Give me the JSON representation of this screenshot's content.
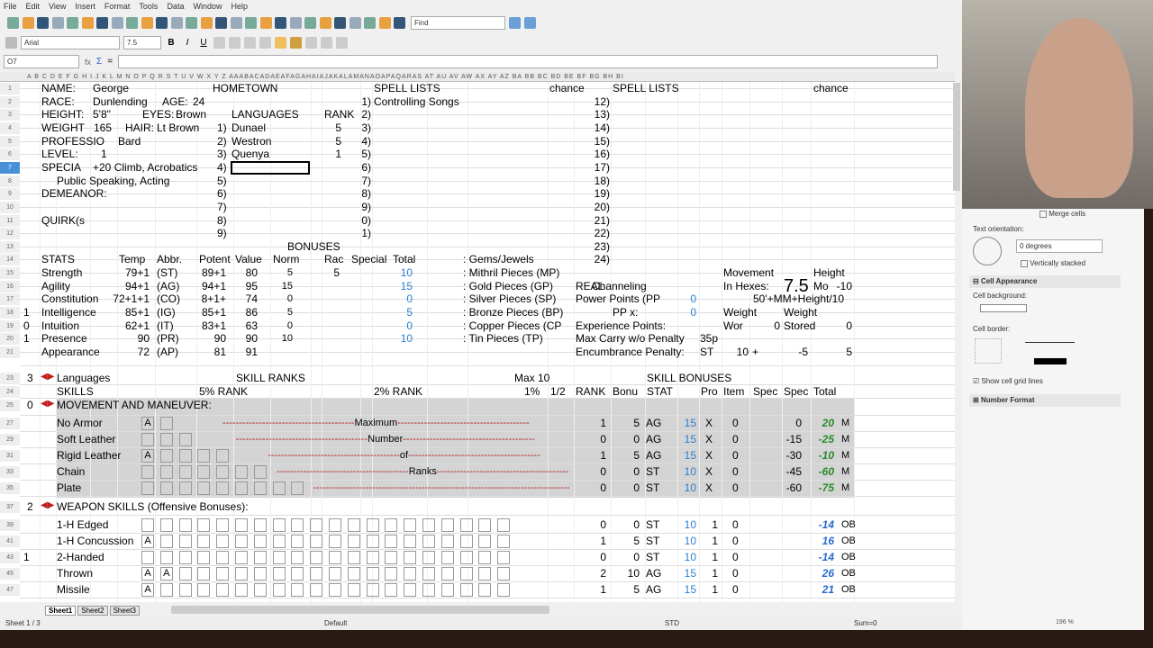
{
  "menu": [
    "File",
    "Edit",
    "View",
    "Insert",
    "Format",
    "Tools",
    "Data",
    "Window",
    "Help"
  ],
  "toolbar": {
    "find_placeholder": "Find",
    "font_name": "Arial",
    "font_size": "7.5",
    "bold": "B",
    "italic": "I",
    "underline": "U"
  },
  "formula_bar": {
    "cell_ref": "O7",
    "fx": "fx",
    "sum": "Σ",
    "eq": "=",
    "content": ""
  },
  "columns": "A  B  C  D  E  F G H I J K L M N O P Q R S T U V W X Y Z AAABACADAEAFAGAHAIAJAKALAMANAOAPAQARAS AT AU AV   AW AX AY AZ  BA  BB  BC  BD  BE BF BG  BH   BI",
  "row_numbers": [
    "1",
    "2",
    "3",
    "4",
    "5",
    "6",
    "7",
    "8",
    "9",
    "10",
    "11",
    "12",
    "13",
    "14",
    "15",
    "16",
    "17",
    "18",
    "19",
    "20",
    "21",
    "23",
    "24",
    "25",
    "27",
    "29",
    "31",
    "33",
    "35",
    "37",
    "39",
    "41",
    "43",
    "45",
    "47"
  ],
  "char": {
    "name_label": "NAME:",
    "name": "George",
    "hometown_label": "HOMETOWN",
    "race_label": "RACE:",
    "race": "Dunlending",
    "age_label": "AGE:",
    "age": "24",
    "height_label": "HEIGHT:",
    "height": "5'8\"",
    "eyes_label": "EYES:",
    "eyes": "Brown",
    "weight_label": "WEIGHT",
    "weight": "165",
    "hair_label": "HAIR:",
    "hair": "Lt Brown",
    "profession_label": "PROFESSIO",
    "profession": "Bard",
    "level_label": "LEVEL:",
    "level": "1",
    "special_label": "SPECIA",
    "special1": "+20 Climb, Acrobatics",
    "special2": "Public Speaking, Acting",
    "demeanor_label": "DEMEANOR:",
    "quirks_label": "QUIRK(s"
  },
  "languages": {
    "header": "LANGUAGES",
    "rank_header": "RANK",
    "items": [
      {
        "num": "1)",
        "name": "Dunael",
        "rank": "5"
      },
      {
        "num": "2)",
        "name": "Westron",
        "rank": "5"
      },
      {
        "num": "3)",
        "name": "Quenya",
        "rank": "1"
      },
      {
        "num": "4)"
      },
      {
        "num": "5)"
      },
      {
        "num": "6)"
      },
      {
        "num": "7)"
      },
      {
        "num": "8)"
      },
      {
        "num": "9)"
      }
    ]
  },
  "spells": {
    "header1": "SPELL LISTS",
    "chance1": "chance",
    "header2": "SPELL LISTS",
    "chance2": "chance",
    "first": "Controlling Songs",
    "nums1": [
      "1)",
      "2)",
      "3)",
      "4)",
      "5)",
      "6)",
      "7)",
      "8)",
      "9)",
      "0)",
      "1)"
    ],
    "nums2": [
      "12)",
      "13)",
      "14)",
      "15)",
      "16)",
      "17)",
      "18)",
      "19)",
      "20)",
      "21)",
      "22)",
      "23)",
      "24)"
    ]
  },
  "stats": {
    "bonuses": "BONUSES",
    "headers": {
      "stats": "STATS",
      "temp": "Temp",
      "abbr": "Abbr.",
      "potent": "Potent",
      "value": "Value",
      "norm": "Norm",
      "race": "Rac",
      "special": "Special",
      "total": "Total"
    },
    "rows": [
      {
        "flag": "",
        "name": "Strength",
        "temp": "79+1",
        "abbr": "(ST)",
        "potent": "89+1",
        "value": "80",
        "norm": "5",
        "race": "5",
        "total": "10"
      },
      {
        "flag": "",
        "name": "Agility",
        "temp": "94+1",
        "abbr": "(AG)",
        "potent": "94+1",
        "value": "95",
        "norm": "15",
        "race": "",
        "total": "15"
      },
      {
        "flag": "",
        "name": "Constitution",
        "temp": "72+1+1",
        "abbr": "(CO)",
        "potent": "8+1+",
        "value": "74",
        "norm": "0",
        "race": "",
        "total": "0"
      },
      {
        "flag": "1",
        "name": "Intelligence",
        "temp": "85+1",
        "abbr": "(IG)",
        "potent": "85+1",
        "value": "86",
        "norm": "5",
        "race": "",
        "total": "5"
      },
      {
        "flag": "0",
        "name": "Intuition",
        "temp": "62+1",
        "abbr": "(IT)",
        "potent": "83+1",
        "value": "63",
        "norm": "0",
        "race": "",
        "total": "0"
      },
      {
        "flag": "1",
        "name": "Presence",
        "temp": "90",
        "abbr": "(PR)",
        "potent": "90",
        "value": "90",
        "norm": "10",
        "race": "",
        "total": "10"
      },
      {
        "flag": "",
        "name": "Appearance",
        "temp": "72",
        "abbr": "(AP)",
        "potent": "81",
        "value": "91",
        "norm": "",
        "race": "",
        "total": ""
      }
    ]
  },
  "money": [
    ": Gems/Jewels",
    ": Mithril Pieces (MP)",
    ": Gold Pieces (GP)",
    ": Silver Pieces (SP)",
    ": Bronze Pieces (BP)",
    ": Copper Pieces (CP",
    ": Tin Pieces (TP)"
  ],
  "misc": {
    "realm_label": "REAL",
    "realm": "Channeling",
    "pp_label": "Power Points (PP",
    "pp": "0",
    "ppx_label": "PP x:",
    "ppx": "0",
    "xp_label": "Experience Points:",
    "maxcarry_label": "Max Carry w/o Penalty",
    "maxcarry": "35p",
    "enc_label": "Encumbrance Penalty:",
    "enc_stat": "ST",
    "enc_val": "10",
    "enc_plus": "+",
    "enc_mod": "-5",
    "enc_total": "5",
    "movement_label": "Movement",
    "hexes_label": "In Hexes:",
    "movement": "7.5",
    "height_label": "Height",
    "mod_label": "Mo",
    "height_mod": "-10",
    "formula": "50'+MM+Height/10",
    "weight1_label": "Weight",
    "weight2_label": "Weight",
    "worn_label": "Wor",
    "worn": "0",
    "stored_label": "Stored",
    "stored": "0"
  },
  "skills": {
    "lang_count": "3",
    "lang_label": "Languages",
    "skill_ranks": "SKILL RANKS",
    "max10": "Max 10",
    "skill_bonuses": "SKILL BONUSES",
    "h_skills": "SKILLS",
    "h_5": "5% RANK",
    "h_2": "2% RANK",
    "h_1": "1%",
    "h_half": "1/2",
    "h_rank": "RANK",
    "h_bonus": "Bonu",
    "h_stat": "STAT",
    "h_pro": "Pro",
    "h_item": "Item",
    "h_spec1": "Spec",
    "h_spec2": "Spec",
    "h_total": "Total",
    "mm_count": "0",
    "mm_label": "MOVEMENT AND MANEUVER:",
    "weap_count": "2",
    "weap_label": "WEAPON SKILLS (Offensive Bonuses):",
    "movement": [
      {
        "name": "No Armor",
        "boxes": [
          "A",
          ""
        ],
        "note": "Maximum",
        "rank": "1",
        "bonus": "5",
        "stat": "AG",
        "statb": "15",
        "prof": "X",
        "item": "0",
        "spec": "0",
        "total": "20",
        "unit": "M"
      },
      {
        "name": "Soft Leather",
        "boxes": [
          "",
          "",
          ""
        ],
        "note": "Number",
        "rank": "0",
        "bonus": "0",
        "stat": "AG",
        "statb": "15",
        "prof": "X",
        "item": "0",
        "spec": "-15",
        "total": "-25",
        "unit": "M"
      },
      {
        "name": "Rigid Leather",
        "boxes": [
          "A",
          "",
          "",
          "",
          ""
        ],
        "note": "of",
        "rank": "1",
        "bonus": "5",
        "stat": "AG",
        "statb": "15",
        "prof": "X",
        "item": "0",
        "spec": "-30",
        "total": "-10",
        "unit": "M"
      },
      {
        "name": "Chain",
        "boxes": [
          "",
          "",
          "",
          "",
          "",
          "",
          ""
        ],
        "note": "Ranks",
        "rank": "0",
        "bonus": "0",
        "stat": "ST",
        "statb": "10",
        "prof": "X",
        "item": "0",
        "spec": "-45",
        "total": "-60",
        "unit": "M"
      },
      {
        "name": "Plate",
        "boxes": [
          "",
          "",
          "",
          "",
          "",
          "",
          "",
          "",
          ""
        ],
        "note": "",
        "rank": "0",
        "bonus": "0",
        "stat": "ST",
        "statb": "10",
        "prof": "X",
        "item": "0",
        "spec": "-60",
        "total": "-75",
        "unit": "M"
      }
    ],
    "weapons": [
      {
        "flag": "",
        "name": "1-H Edged",
        "boxes": [
          "",
          "",
          "",
          "",
          "",
          "",
          "",
          "",
          "",
          "",
          "",
          "",
          "",
          "",
          "",
          "",
          "",
          "",
          "",
          ""
        ],
        "rank": "0",
        "bonus": "0",
        "stat": "ST",
        "statb": "10",
        "prof": "1",
        "item": "0",
        "total": "-14",
        "unit": "OB"
      },
      {
        "flag": "",
        "name": "1-H Concussion",
        "boxes": [
          "A",
          "",
          "",
          "",
          "",
          "",
          "",
          "",
          "",
          "",
          "",
          "",
          "",
          "",
          "",
          "",
          "",
          "",
          "",
          ""
        ],
        "rank": "1",
        "bonus": "5",
        "stat": "ST",
        "statb": "10",
        "prof": "1",
        "item": "0",
        "total": "16",
        "unit": "OB"
      },
      {
        "flag": "1",
        "name": "2-Handed",
        "boxes": [
          "",
          "",
          "",
          "",
          "",
          "",
          "",
          "",
          "",
          "",
          "",
          "",
          "",
          "",
          "",
          "",
          "",
          "",
          "",
          ""
        ],
        "rank": "0",
        "bonus": "0",
        "stat": "ST",
        "statb": "10",
        "prof": "1",
        "item": "0",
        "total": "-14",
        "unit": "OB"
      },
      {
        "flag": "",
        "name": "Thrown",
        "boxes": [
          "A",
          "A",
          "",
          "",
          "",
          "",
          "",
          "",
          "",
          "",
          "",
          "",
          "",
          "",
          "",
          "",
          "",
          "",
          "",
          ""
        ],
        "rank": "2",
        "bonus": "10",
        "stat": "AG",
        "statb": "15",
        "prof": "1",
        "item": "0",
        "total": "26",
        "unit": "OB"
      },
      {
        "flag": "",
        "name": "Missile",
        "boxes": [
          "A",
          "",
          "",
          "",
          "",
          "",
          "",
          "",
          "",
          "",
          "",
          "",
          "",
          "",
          "",
          "",
          "",
          "",
          "",
          ""
        ],
        "rank": "1",
        "bonus": "5",
        "stat": "AG",
        "statb": "15",
        "prof": "1",
        "item": "0",
        "total": "21",
        "unit": "OB"
      }
    ]
  },
  "sidebar": {
    "merge_cells": "Merge cells",
    "text_orientation": "Text orientation:",
    "degrees": "0 degrees",
    "vertically_stacked": "Vertically stacked",
    "cell_appearance": "Cell Appearance",
    "cell_background": "Cell background:",
    "cell_border": "Cell border:",
    "show_grid": "Show cell grid lines",
    "number_format": "Number Format"
  },
  "sheet_tabs": [
    "Sheet1",
    "Sheet2",
    "Sheet3"
  ],
  "status": {
    "sheet": "Sheet 1 / 3",
    "style": "Default",
    "mode": "STD",
    "sum": "Sum=0",
    "zoom": "196 %"
  }
}
